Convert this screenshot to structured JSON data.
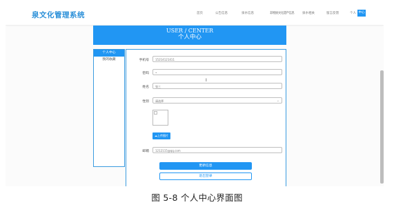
{
  "brand": "泉文化管理系统",
  "nav": {
    "items": [
      "首页",
      "公告信息",
      "泉水信息",
      "非物质文化遗产信息",
      "泉水相关",
      "留言反馈"
    ],
    "active_label": "个人",
    "active_badge": "中心"
  },
  "banner": {
    "en": "USER / CENTER",
    "cn": "个人中心"
  },
  "sidebar": {
    "items": [
      "个人中心",
      "我的收藏"
    ]
  },
  "form": {
    "phone_label": "手机号",
    "phone_value": "15214121411",
    "password_label": "密码",
    "password_value": "•",
    "name_label": "姓名",
    "name_value": "张三",
    "gender_label": "性别",
    "gender_value": "请选择",
    "upload_label": "上传图片",
    "email_label": "邮箱",
    "email_value": "1212115@qq.com"
  },
  "buttons": {
    "update": "更新信息",
    "logout": "退出登录"
  },
  "caption": "图 5-8 个人中心界面图"
}
